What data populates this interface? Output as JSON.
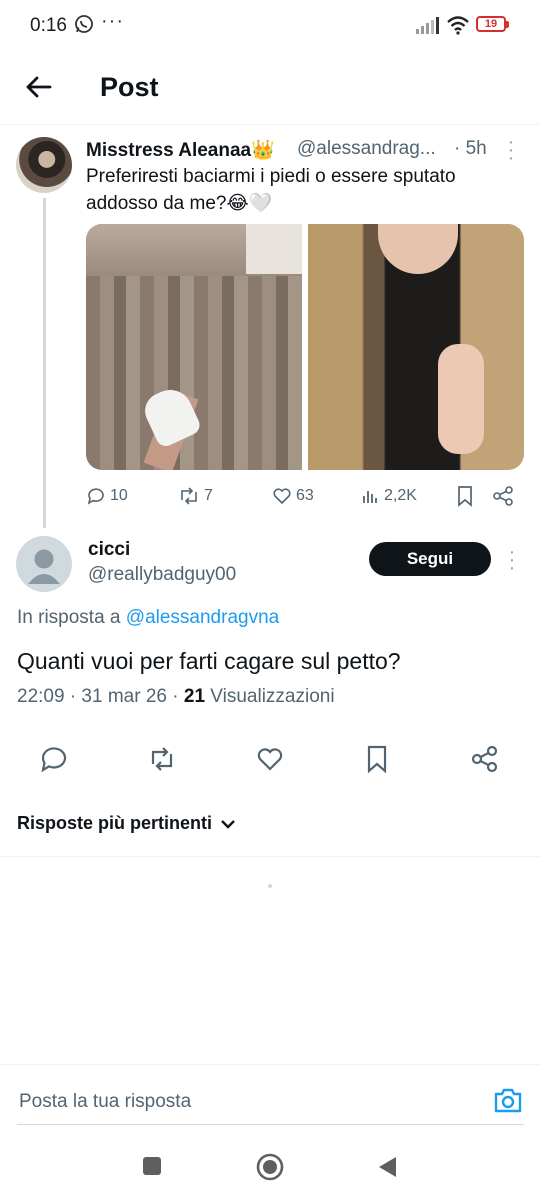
{
  "status_bar": {
    "time": "0:16",
    "more": "···",
    "battery": "19"
  },
  "header": {
    "title": "Post"
  },
  "parent_post": {
    "author_name": "Misstress Aleanaa👑",
    "handle": "@alessandrag...",
    "time": "· 5h",
    "text": "Preferiresti baciarmi i piedi o essere sputato addosso da me?😂🤍",
    "stats": {
      "replies": "10",
      "reposts": "7",
      "likes": "63",
      "views": "2,2K"
    }
  },
  "reply_post": {
    "author_name": "cicci",
    "handle": "@reallybadguy00",
    "follow_label": "Segui",
    "in_reply_prefix": "In risposta a",
    "in_reply_handle": "@alessandragvna",
    "text": "Quanti vuoi per farti cagare sul petto?",
    "timestamp": "22:09 · 31 mar 26 ·",
    "views_count": "21",
    "views_label": "Visualizzazioni"
  },
  "replies_sort": {
    "label": "Risposte più pertinenti"
  },
  "composer": {
    "placeholder": "Posta la tua risposta"
  },
  "colors": {
    "accent": "#1d9bf0",
    "text": "#0f1419",
    "muted": "#536471"
  }
}
